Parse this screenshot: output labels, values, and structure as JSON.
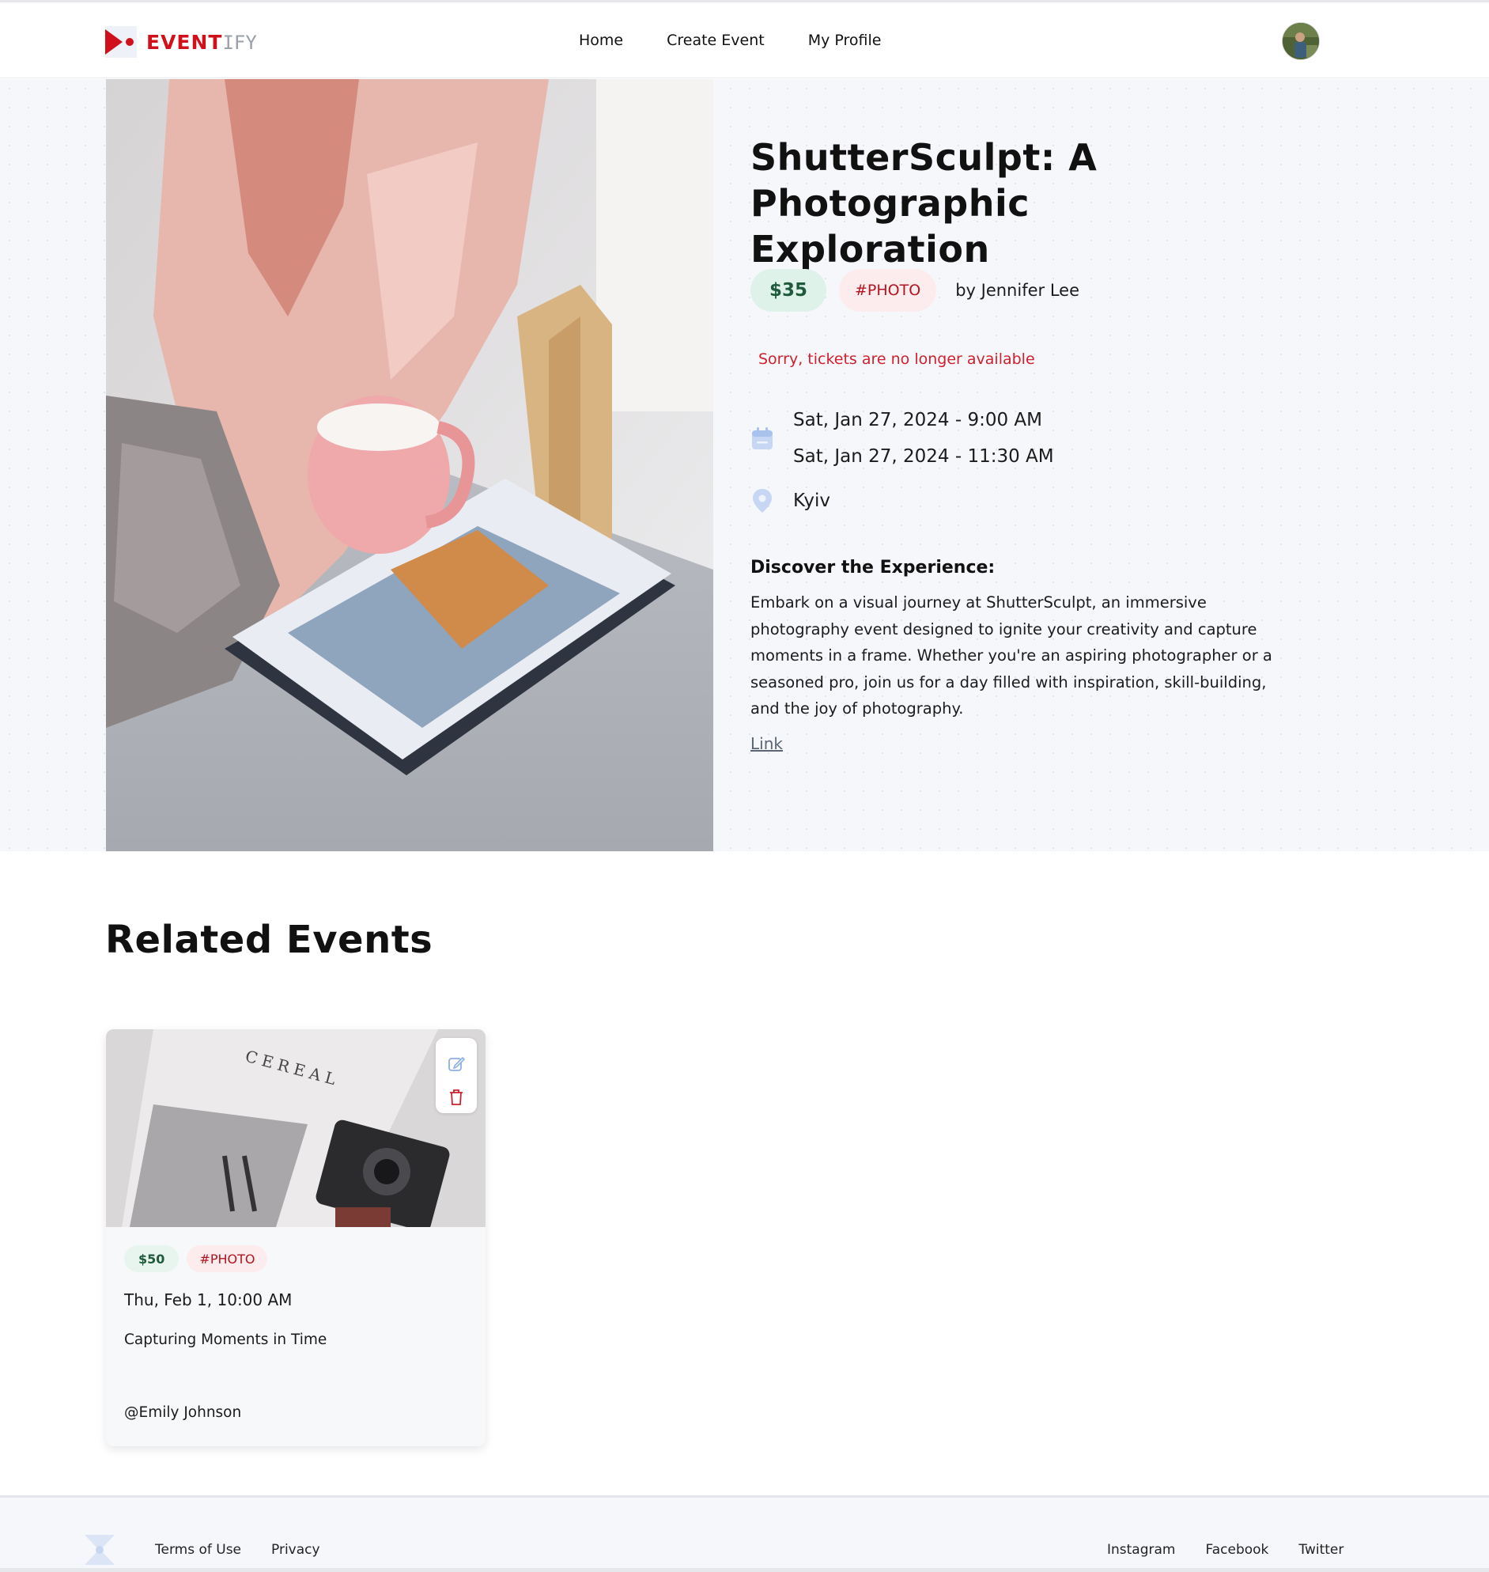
{
  "brand": {
    "name_primary": "EVENT",
    "name_secondary": "IFY",
    "accent": "#d0101a"
  },
  "nav": {
    "items": [
      "Home",
      "Create Event",
      "My Profile"
    ]
  },
  "event": {
    "title": "ShutterSculpt: A Photographic Exploration",
    "price": "$35",
    "tag": "#PHOTO",
    "organizer": "by Jennifer Lee",
    "availability": "Sorry, tickets are no longer available",
    "start": "Sat, Jan 27, 2024 - 9:00 AM",
    "end": "Sat, Jan 27, 2024 - 11:30 AM",
    "location": "Kyiv",
    "description_heading": "Discover the Experience:",
    "description": "Embark on a visual journey at ShutterSculpt, an immersive photography event designed to ignite your creativity and capture moments in a frame. Whether you're an aspiring photographer or a seasoned pro, join us for a day filled with inspiration, skill-building, and the joy of photography.",
    "link_label": "Link"
  },
  "related": {
    "heading": "Related Events",
    "cards": [
      {
        "price": "$50",
        "tag": "#PHOTO",
        "date": "Thu, Feb 1, 10:00 AM",
        "title": "Capturing Moments in Time",
        "organizer": "@Emily Johnson",
        "image_text": "CEREAL"
      }
    ]
  },
  "footer": {
    "links_left": [
      "Terms of Use",
      "Privacy"
    ],
    "links_right": [
      "Instagram",
      "Facebook",
      "Twitter"
    ]
  },
  "icons": [
    "calendar-icon",
    "location-pin-icon",
    "edit-icon",
    "trash-icon"
  ]
}
